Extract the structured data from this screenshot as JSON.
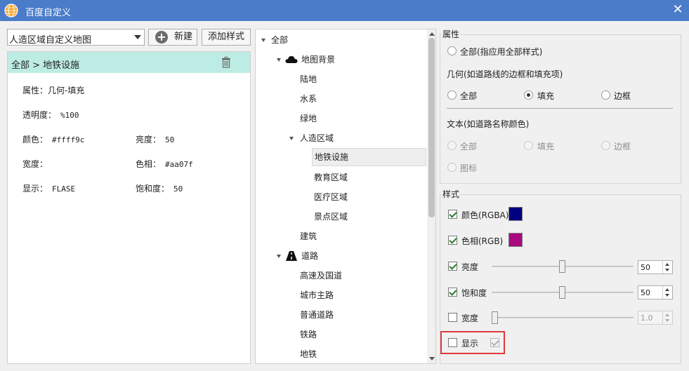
{
  "window": {
    "title": "百度自定义"
  },
  "left": {
    "combo_value": "人造区域自定义地图",
    "new_label": "新建",
    "add_style_label": "添加样式",
    "breadcrumb": "全部 > 地铁设施",
    "props": {
      "attr_key": "属性：",
      "attr_val": "几何-填充",
      "opacity_key": "透明度：",
      "opacity_val": "%100",
      "color_key": "颜色：",
      "color_val": "#ffff9c",
      "brightness_key": "亮度：",
      "brightness_val": "50",
      "width_key": "宽度：",
      "width_val": "",
      "hue_key": "色相：",
      "hue_val": "#aa07f",
      "visible_key": "显示：",
      "visible_val": "FLASE",
      "saturation_key": "饱和度：",
      "saturation_val": "50"
    }
  },
  "tree": {
    "items": [
      {
        "label": "全部",
        "expanded": true
      },
      {
        "label": "地图背景",
        "expanded": true,
        "icon": "cloud-icon"
      },
      {
        "label": "陆地"
      },
      {
        "label": "水系"
      },
      {
        "label": "绿地"
      },
      {
        "label": "人造区域",
        "expanded": true
      },
      {
        "label": "地铁设施",
        "selected": true
      },
      {
        "label": "教育区域"
      },
      {
        "label": "医疗区域"
      },
      {
        "label": "景点区域"
      },
      {
        "label": "建筑"
      },
      {
        "label": "道路",
        "expanded": true,
        "icon": "road-icon"
      },
      {
        "label": "高速及国道"
      },
      {
        "label": "城市主路"
      },
      {
        "label": "普通道路"
      },
      {
        "label": "铁路"
      },
      {
        "label": "地铁"
      }
    ]
  },
  "attributes": {
    "group_title": "属性",
    "all_option": "全部(指应用全部样式)",
    "geometry_label": "几何(如道路线的边框和填充项)",
    "geometry_options": [
      "全部",
      "填充",
      "边框"
    ],
    "geometry_selected": "填充",
    "text_label": "文本(如道路名称颜色)",
    "text_options": [
      "全部",
      "填充",
      "边框",
      "图标"
    ]
  },
  "style": {
    "group_title": "样式",
    "color_label": "颜色(RGBA)",
    "color_value": "#000080",
    "hue_label": "色相(RGB)",
    "hue_value": "#aa0a7f",
    "brightness_label": "亮度",
    "brightness_value": "50",
    "brightness_level_percent": 50,
    "saturation_label": "饱和度",
    "saturation_value": "50",
    "saturation_level_percent": 50,
    "width_label": "宽度",
    "width_value": "1.0",
    "visible_label": "显示"
  }
}
